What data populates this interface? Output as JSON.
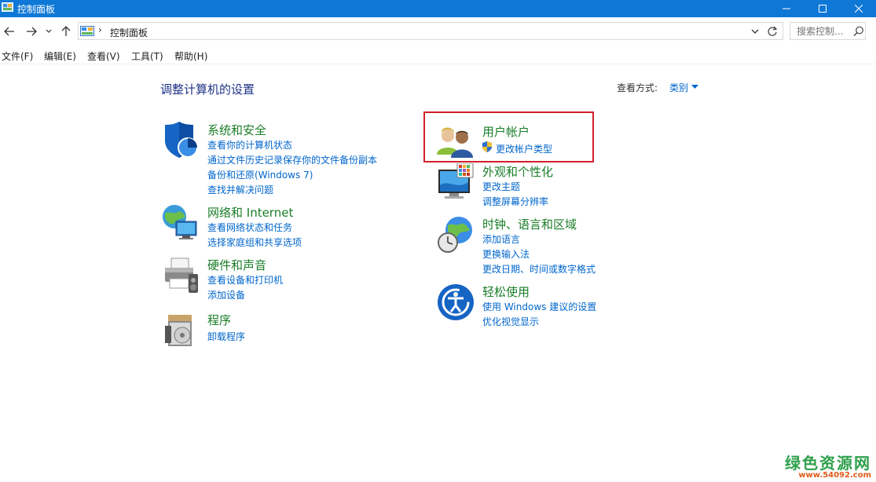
{
  "window": {
    "title": "控制面板",
    "minimize_icon": "minimize-icon",
    "maximize_icon": "maximize-icon",
    "close_icon": "close-icon"
  },
  "address": {
    "path": "控制面板",
    "separator": "›",
    "search_placeholder": "搜索控制..."
  },
  "menu": [
    {
      "label": "文件(F)"
    },
    {
      "label": "编辑(E)"
    },
    {
      "label": "查看(V)"
    },
    {
      "label": "工具(T)"
    },
    {
      "label": "帮助(H)"
    }
  ],
  "main": {
    "title": "调整计算机的设置",
    "view_by_label": "查看方式:",
    "view_by_value": "类别"
  },
  "categories": [
    {
      "heading": "系统和安全",
      "icon": "shield-icon",
      "links": [
        "查看你的计算机状态",
        "通过文件历史记录保存你的文件备份副本",
        "备份和还原(Windows 7)",
        "查找并解决问题"
      ]
    },
    {
      "heading": "网络和 Internet",
      "icon": "network-globe-icon",
      "links": [
        "查看网络状态和任务",
        "选择家庭组和共享选项"
      ]
    },
    {
      "heading": "硬件和声音",
      "icon": "printer-icon",
      "links": [
        "查看设备和打印机",
        "添加设备"
      ]
    },
    {
      "heading": "程序",
      "icon": "programs-icon",
      "links": [
        "卸载程序"
      ]
    },
    {
      "heading": "用户帐户",
      "icon": "users-icon",
      "links": [
        "更改帐户类型"
      ]
    },
    {
      "heading": "外观和个性化",
      "icon": "appearance-monitor-icon",
      "links": [
        "更改主题",
        "调整屏幕分辨率"
      ]
    },
    {
      "heading": "时钟、语言和区域",
      "icon": "clock-globe-icon",
      "links": [
        "添加语言",
        "更换输入法",
        "更改日期、时间或数字格式"
      ]
    },
    {
      "heading": "轻松使用",
      "icon": "ease-of-access-icon",
      "links": [
        "使用 Windows 建议的设置",
        "优化视觉显示"
      ]
    }
  ],
  "watermark": {
    "name": "绿色资源网",
    "url": "www.54092.com"
  },
  "colors": {
    "titlebar": "#0f78d7",
    "heading_green": "#1a7d28",
    "link_blue": "#0066cc",
    "highlight_red": "#d0202a"
  }
}
